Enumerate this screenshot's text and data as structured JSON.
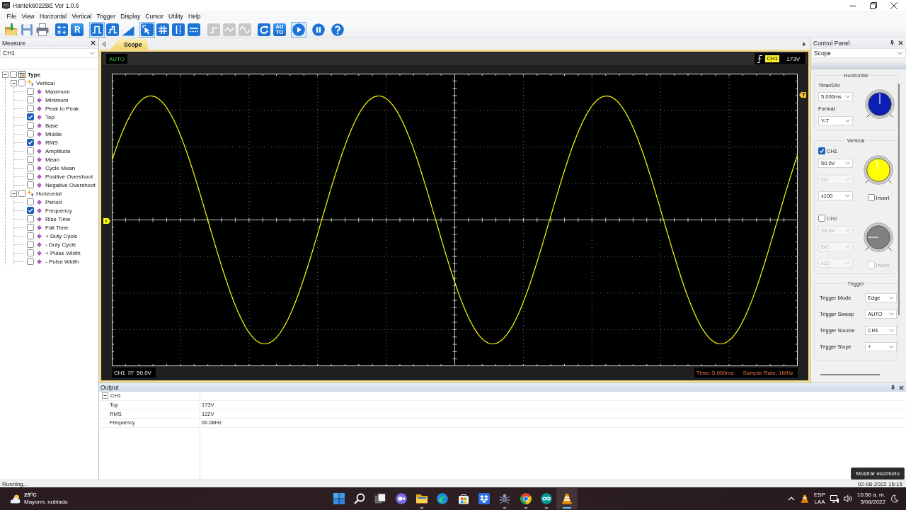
{
  "window": {
    "title": "Hantek6022BE Ver 1.0.6"
  },
  "menu": [
    "File",
    "View",
    "Horizontal",
    "Vertical",
    "Trigger",
    "Display",
    "Cursor",
    "Utility",
    "Help"
  ],
  "toolbar": [
    [
      {
        "kind": "open",
        "selected": false,
        "disabled": false
      },
      {
        "kind": "save",
        "selected": false,
        "disabled": false
      },
      {
        "kind": "print",
        "selected": false,
        "disabled": false
      }
    ],
    [
      {
        "kind": "math",
        "selected": false,
        "disabled": false
      },
      {
        "kind": "ref",
        "label": "R",
        "selected": false,
        "disabled": false
      }
    ],
    [
      {
        "kind": "pulse",
        "selected": true,
        "disabled": false
      },
      {
        "kind": "step",
        "selected": false,
        "disabled": false
      },
      {
        "kind": "ramp",
        "selected": false,
        "disabled": false
      }
    ],
    [
      {
        "kind": "select",
        "selected": true,
        "disabled": false
      },
      {
        "kind": "grid",
        "selected": false,
        "disabled": false
      },
      {
        "kind": "vcursor",
        "selected": false,
        "disabled": false
      },
      {
        "kind": "hcursor",
        "selected": false,
        "disabled": false
      }
    ],
    [
      {
        "kind": "step2",
        "selected": false,
        "disabled": true
      },
      {
        "kind": "wave",
        "selected": false,
        "disabled": true
      },
      {
        "kind": "sine",
        "selected": false,
        "disabled": true
      }
    ],
    [
      {
        "kind": "refresh",
        "selected": false,
        "disabled": false
      },
      {
        "kind": "auto",
        "label": "AUTO",
        "selected": false,
        "disabled": false
      }
    ],
    [
      {
        "kind": "run",
        "selected": true,
        "disabled": false
      }
    ],
    [
      {
        "kind": "pause",
        "selected": false,
        "disabled": false
      }
    ],
    [
      {
        "kind": "help",
        "selected": false,
        "disabled": false
      }
    ]
  ],
  "measure_panel": {
    "title": "Measure",
    "channel": "CH1",
    "tree": [
      {
        "label": "Type",
        "checked": false,
        "expanded": true,
        "children": [
          {
            "label": "Vertical",
            "checked": false,
            "expanded": true,
            "children": [
              {
                "label": "Maximum",
                "checked": false
              },
              {
                "label": "Minimum",
                "checked": false
              },
              {
                "label": "Peak to Peak",
                "checked": false
              },
              {
                "label": "Top",
                "checked": true
              },
              {
                "label": "Base",
                "checked": false
              },
              {
                "label": "Middle",
                "checked": false
              },
              {
                "label": "RMS",
                "checked": true
              },
              {
                "label": "Amplitude",
                "checked": false
              },
              {
                "label": "Mean",
                "checked": false
              },
              {
                "label": "Cycle Mean",
                "checked": false
              },
              {
                "label": "Positive Overshoot",
                "checked": false
              },
              {
                "label": "Negative Overshoot",
                "checked": false
              }
            ]
          },
          {
            "label": "Horizontal",
            "checked": false,
            "expanded": true,
            "children": [
              {
                "label": "Period",
                "checked": false
              },
              {
                "label": "Frequency",
                "checked": true
              },
              {
                "label": "Rise Time",
                "checked": false
              },
              {
                "label": "Fall Time",
                "checked": false
              },
              {
                "label": "+ Duty Cycle",
                "checked": false
              },
              {
                "label": "- Duty Cycle",
                "checked": false
              },
              {
                "label": "+ Pulse Width",
                "checked": false
              },
              {
                "label": "- Pulse Width",
                "checked": false
              }
            ]
          }
        ]
      }
    ]
  },
  "scope_tab": {
    "label": "Scope",
    "selected": true
  },
  "scope": {
    "mode": "AUTO",
    "trigger_channel": "CH1",
    "trigger_level": "173V",
    "channel": "CH1",
    "volts_div": "50.0V",
    "time": "Time: 5.000ms",
    "sample_rate": "Sample Rate: 1MHz"
  },
  "control_panel": {
    "title": "Control Panel",
    "view": "Scope",
    "horizontal": {
      "title": "Horizontal",
      "time_div_label": "Time/DIV",
      "time_div": "5.000ms",
      "format_label": "Format",
      "format": "Y-T"
    },
    "vertical": {
      "title": "Vertical",
      "channels": [
        {
          "name": "CH1",
          "checked": true,
          "color": "#ffff00",
          "volts": {
            "value": "50.0V",
            "disabled": false
          },
          "coupling": {
            "value": "DC",
            "disabled": true
          },
          "probe": {
            "value": "x100",
            "disabled": false
          },
          "invert": {
            "label": "Invert",
            "checked": false,
            "disabled": false
          }
        },
        {
          "name": "CH2",
          "checked": false,
          "color": "#808080",
          "volts": {
            "value": "20.0V",
            "disabled": true
          },
          "coupling": {
            "value": "DC",
            "disabled": true
          },
          "probe": {
            "value": "x10",
            "disabled": true
          },
          "invert": {
            "label": "Invert",
            "checked": false,
            "disabled": true
          }
        }
      ]
    },
    "trigger": {
      "title": "Trigger",
      "fields": [
        {
          "label": "Trigger Mode",
          "value": "Edge"
        },
        {
          "label": "Trigger Sweep",
          "value": "AUTO"
        },
        {
          "label": "Trigger Source",
          "value": "CH1"
        },
        {
          "label": "Trigger Slope",
          "value": "+"
        }
      ]
    }
  },
  "output": {
    "title": "Output",
    "groups": [
      {
        "name": "CH1",
        "expanded": true,
        "rows": [
          {
            "name": "Top",
            "value": "173V"
          },
          {
            "name": "RMS",
            "value": "122V"
          },
          {
            "name": "Frequency",
            "value": "60.08Hz"
          }
        ]
      }
    ]
  },
  "status_bar": {
    "text": "Running...",
    "datetime": "02-08-2022 15:15"
  },
  "taskbar": {
    "weather": {
      "temperature": "25°C",
      "condition": "Mayorm. nublado"
    },
    "apps": [
      {
        "kind": "start",
        "running": false,
        "active": false
      },
      {
        "kind": "search",
        "running": false,
        "active": false
      },
      {
        "kind": "taskview",
        "running": false,
        "active": false
      },
      {
        "kind": "chat",
        "running": false,
        "active": false
      },
      {
        "kind": "explorer",
        "running": true,
        "active": false
      },
      {
        "kind": "edge",
        "running": false,
        "active": false
      },
      {
        "kind": "store",
        "running": false,
        "active": false
      },
      {
        "kind": "dropbox",
        "running": false,
        "active": false
      },
      {
        "kind": "bug",
        "running": true,
        "active": false
      },
      {
        "kind": "chrome",
        "running": true,
        "active": false
      },
      {
        "kind": "arduino",
        "running": true,
        "active": false
      },
      {
        "kind": "vlc",
        "running": true,
        "active": true
      }
    ],
    "tray": {
      "language": "ESP",
      "layout": "LAA",
      "time": "10:56 a. m.",
      "date": "3/08/2022"
    },
    "tooltip": "Mostrar escritorio"
  }
}
